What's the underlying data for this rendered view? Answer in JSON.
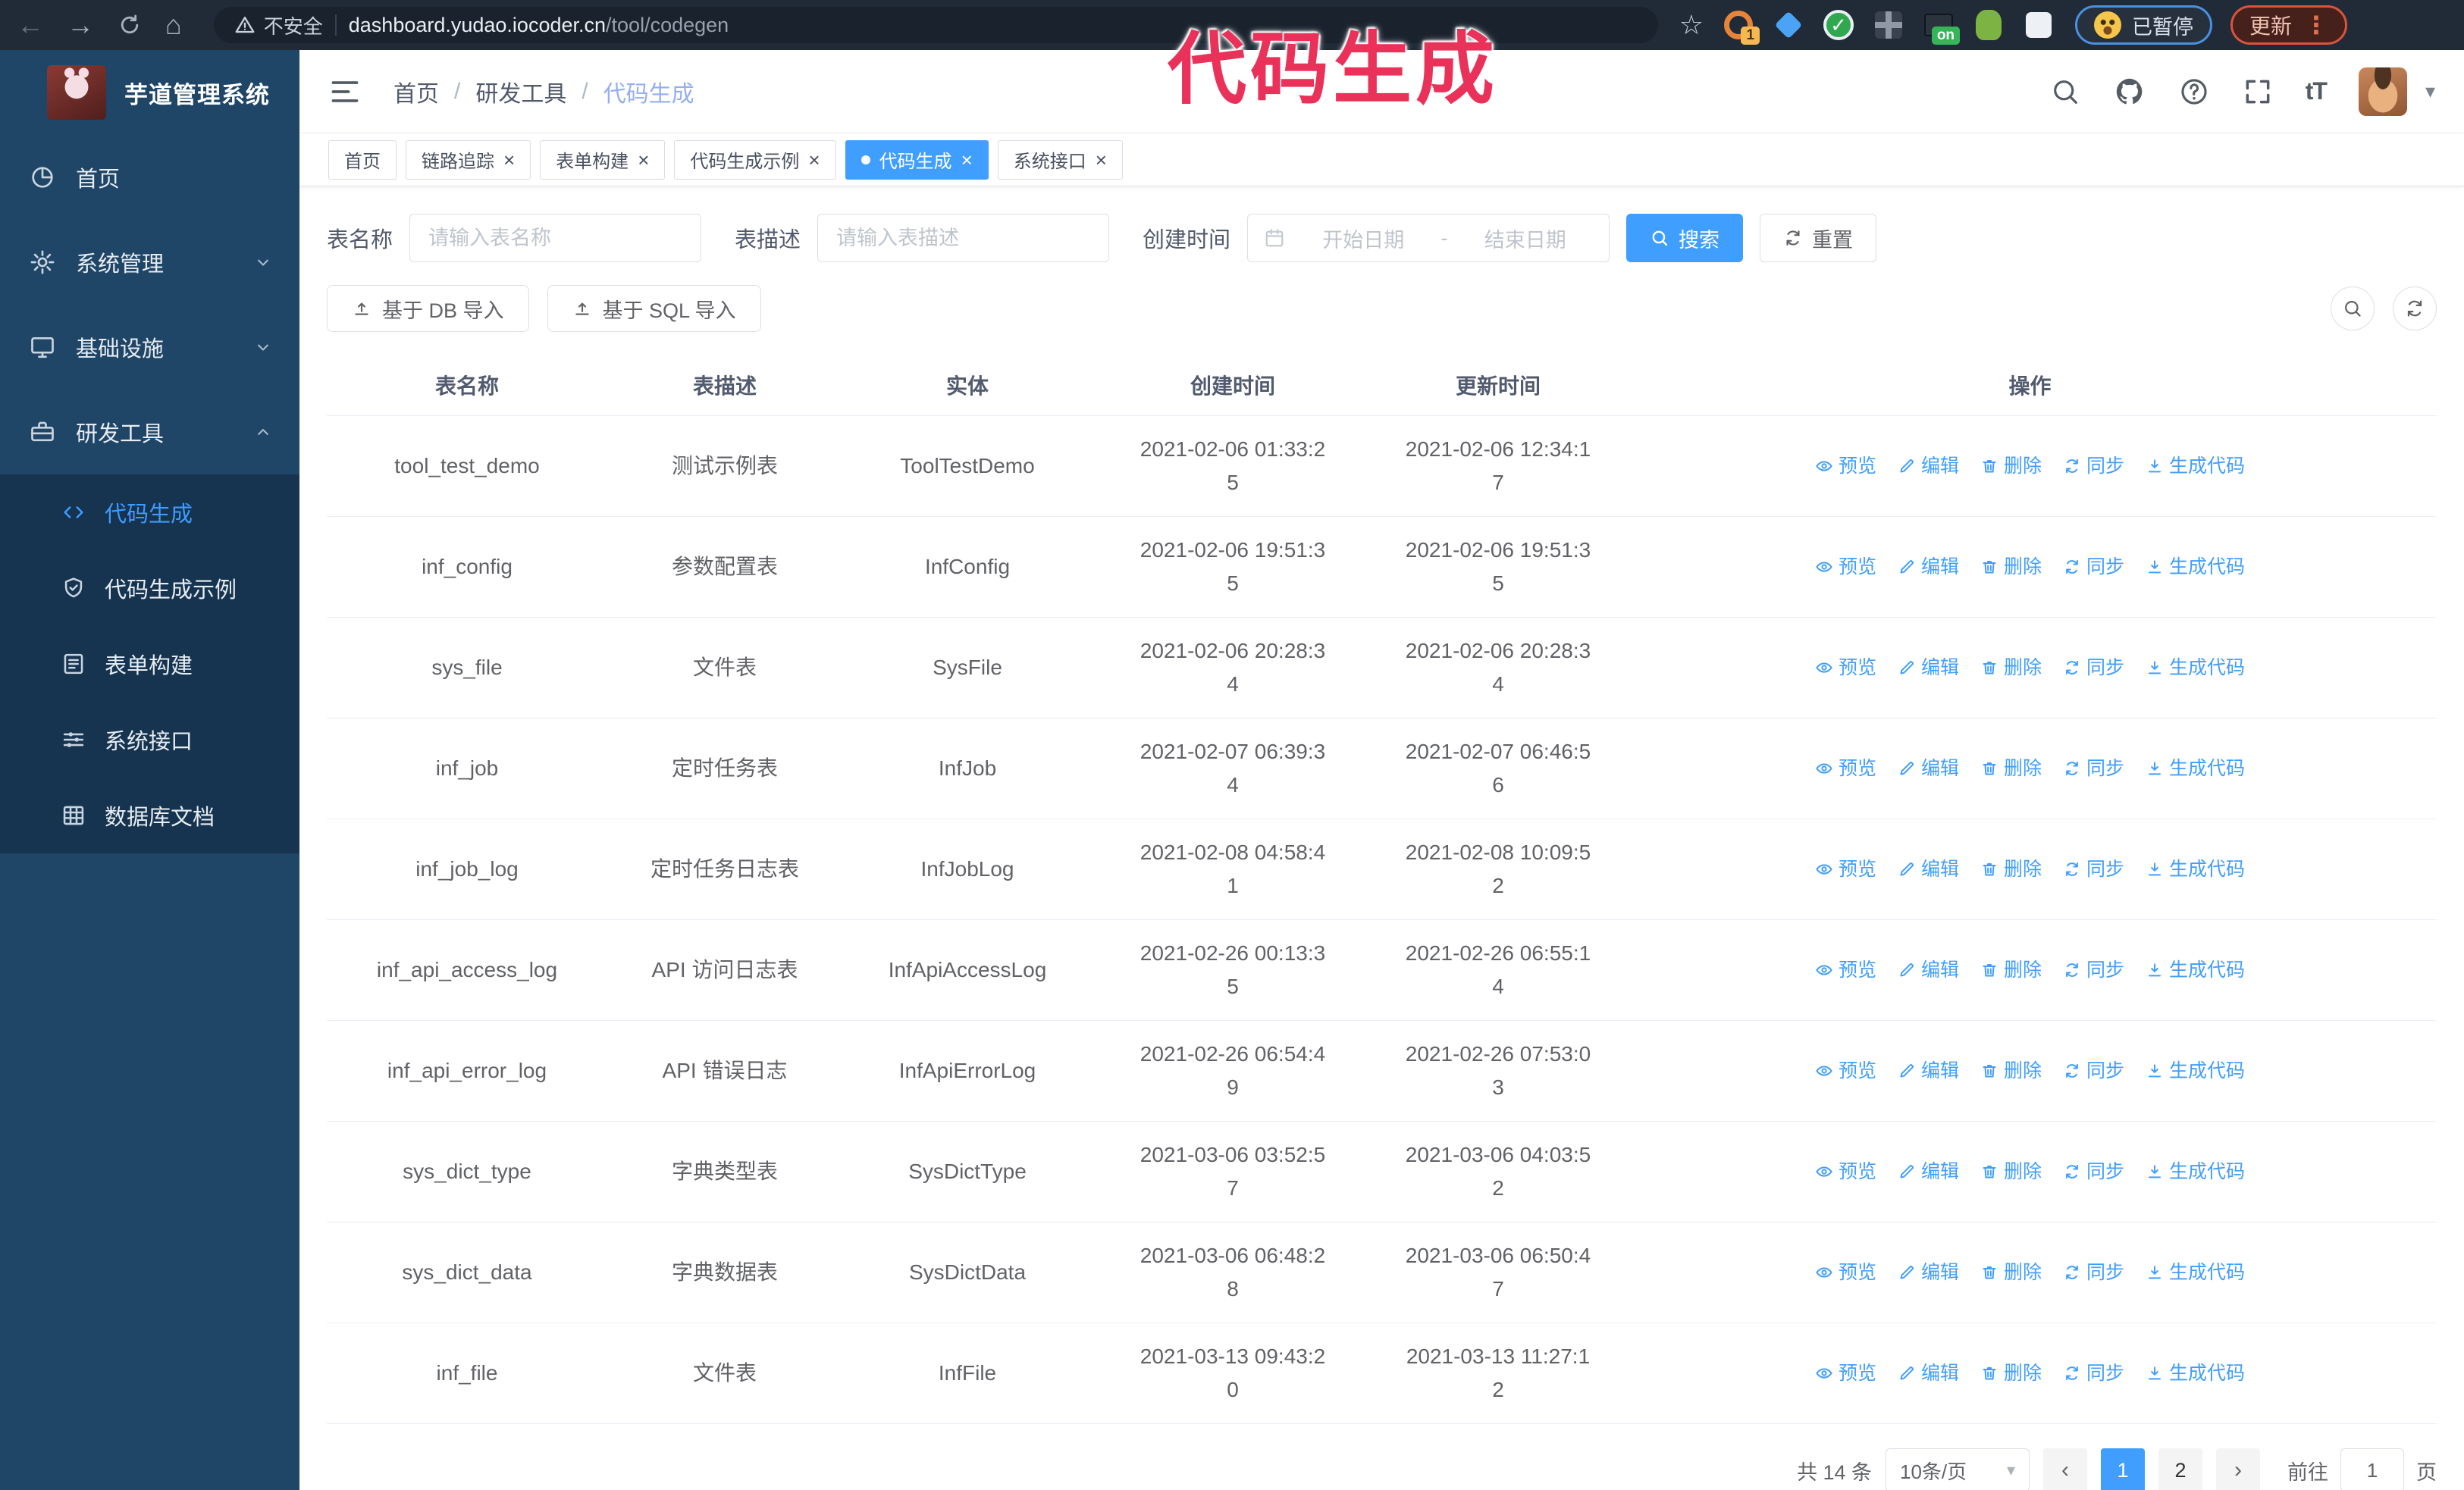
{
  "browser": {
    "security_label": "不安全",
    "url_domain": "dashboard.yudao.iocoder.cn",
    "url_path": "/tool/codegen",
    "extension_badge_1": "1",
    "extension_badge_on": "on",
    "paused_label": "已暂停",
    "update_label": "更新"
  },
  "watermark": "代码生成",
  "app": {
    "title": "芋道管理系统"
  },
  "breadcrumb": [
    "首页",
    "研发工具",
    "代码生成"
  ],
  "header": {
    "font_size_label": "tT"
  },
  "sidebar": {
    "items": [
      {
        "label": "首页",
        "icon": "dashboard-icon"
      },
      {
        "label": "系统管理",
        "icon": "gear-icon",
        "expandable": true
      },
      {
        "label": "基础设施",
        "icon": "monitor-icon",
        "expandable": true
      },
      {
        "label": "研发工具",
        "icon": "toolbox-icon",
        "expandable": true,
        "expanded": true,
        "children": [
          {
            "label": "代码生成",
            "icon": "code-icon",
            "active": true
          },
          {
            "label": "代码生成示例",
            "icon": "shield-check-icon"
          },
          {
            "label": "表单构建",
            "icon": "form-icon"
          },
          {
            "label": "系统接口",
            "icon": "sliders-icon"
          },
          {
            "label": "数据库文档",
            "icon": "table-grid-icon"
          }
        ]
      }
    ]
  },
  "tabs": [
    {
      "label": "首页",
      "closable": false,
      "active": false
    },
    {
      "label": "链路追踪",
      "closable": true,
      "active": false
    },
    {
      "label": "表单构建",
      "closable": true,
      "active": false
    },
    {
      "label": "代码生成示例",
      "closable": true,
      "active": false
    },
    {
      "label": "代码生成",
      "closable": true,
      "active": true
    },
    {
      "label": "系统接口",
      "closable": true,
      "active": false
    }
  ],
  "filters": {
    "table_name_label": "表名称",
    "table_name_placeholder": "请输入表名称",
    "table_desc_label": "表描述",
    "table_desc_placeholder": "请输入表描述",
    "create_time_label": "创建时间",
    "date_start_placeholder": "开始日期",
    "date_separator": "-",
    "date_end_placeholder": "结束日期",
    "search_label": "搜索",
    "reset_label": "重置"
  },
  "toolbar": {
    "import_db_label": "基于 DB 导入",
    "import_sql_label": "基于 SQL 导入"
  },
  "table": {
    "columns": [
      "表名称",
      "表描述",
      "实体",
      "创建时间",
      "更新时间",
      "操作"
    ],
    "actions": [
      "预览",
      "编辑",
      "删除",
      "同步",
      "生成代码"
    ],
    "rows": [
      {
        "name": "tool_test_demo",
        "desc": "测试示例表",
        "entity": "ToolTestDemo",
        "created": "2021-02-06 01:33:25",
        "updated": "2021-02-06 12:34:17"
      },
      {
        "name": "inf_config",
        "desc": "参数配置表",
        "entity": "InfConfig",
        "created": "2021-02-06 19:51:35",
        "updated": "2021-02-06 19:51:35"
      },
      {
        "name": "sys_file",
        "desc": "文件表",
        "entity": "SysFile",
        "created": "2021-02-06 20:28:34",
        "updated": "2021-02-06 20:28:34"
      },
      {
        "name": "inf_job",
        "desc": "定时任务表",
        "entity": "InfJob",
        "created": "2021-02-07 06:39:34",
        "updated": "2021-02-07 06:46:56"
      },
      {
        "name": "inf_job_log",
        "desc": "定时任务日志表",
        "entity": "InfJobLog",
        "created": "2021-02-08 04:58:41",
        "updated": "2021-02-08 10:09:52"
      },
      {
        "name": "inf_api_access_log",
        "desc": "API 访问日志表",
        "entity": "InfApiAccessLog",
        "created": "2021-02-26 00:13:35",
        "updated": "2021-02-26 06:55:14"
      },
      {
        "name": "inf_api_error_log",
        "desc": "API 错误日志",
        "entity": "InfApiErrorLog",
        "created": "2021-02-26 06:54:49",
        "updated": "2021-02-26 07:53:03"
      },
      {
        "name": "sys_dict_type",
        "desc": "字典类型表",
        "entity": "SysDictType",
        "created": "2021-03-06 03:52:57",
        "updated": "2021-03-06 04:03:52"
      },
      {
        "name": "sys_dict_data",
        "desc": "字典数据表",
        "entity": "SysDictData",
        "created": "2021-03-06 06:48:28",
        "updated": "2021-03-06 06:50:47"
      },
      {
        "name": "inf_file",
        "desc": "文件表",
        "entity": "InfFile",
        "created": "2021-03-13 09:43:20",
        "updated": "2021-03-13 11:27:12"
      }
    ]
  },
  "pagination": {
    "total_label": "共 14 条",
    "page_size_label": "10条/页",
    "pages": [
      "1",
      "2"
    ],
    "active_page": "1",
    "goto_label": "前往",
    "goto_value": "1",
    "page_suffix_label": "页"
  }
}
